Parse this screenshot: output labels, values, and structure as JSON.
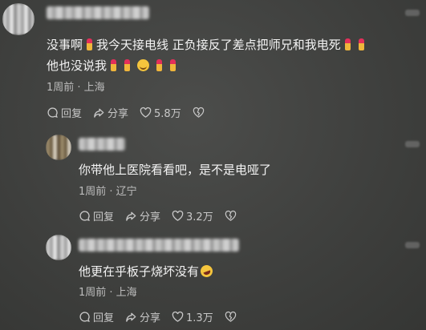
{
  "comments": [
    {
      "line1_parts": [
        "没事啊",
        "我今天接电线 正负接反了差点把师兄和我电死"
      ],
      "line2_parts": [
        "他也没说我"
      ],
      "meta": "1周前 · 上海",
      "reply_label": "回复",
      "share_label": "分享",
      "likes": "5.8万"
    },
    {
      "text": "你带他上医院看看吧，是不是电哑了",
      "meta": "1周前 · 辽宁",
      "reply_label": "回复",
      "share_label": "分享",
      "likes": "3.2万"
    },
    {
      "text": "他更在乎板子烧坏没有",
      "meta": "1周前 · 上海",
      "reply_label": "回复",
      "share_label": "分享",
      "likes": "1.3万"
    }
  ],
  "icons": [
    "lipstick-emoji-icon",
    "smile-emoji-icon",
    "laugh-cry-emoji-icon",
    "comment-icon",
    "share-icon",
    "heart-icon",
    "heart-broken-icon",
    "more-icon"
  ]
}
